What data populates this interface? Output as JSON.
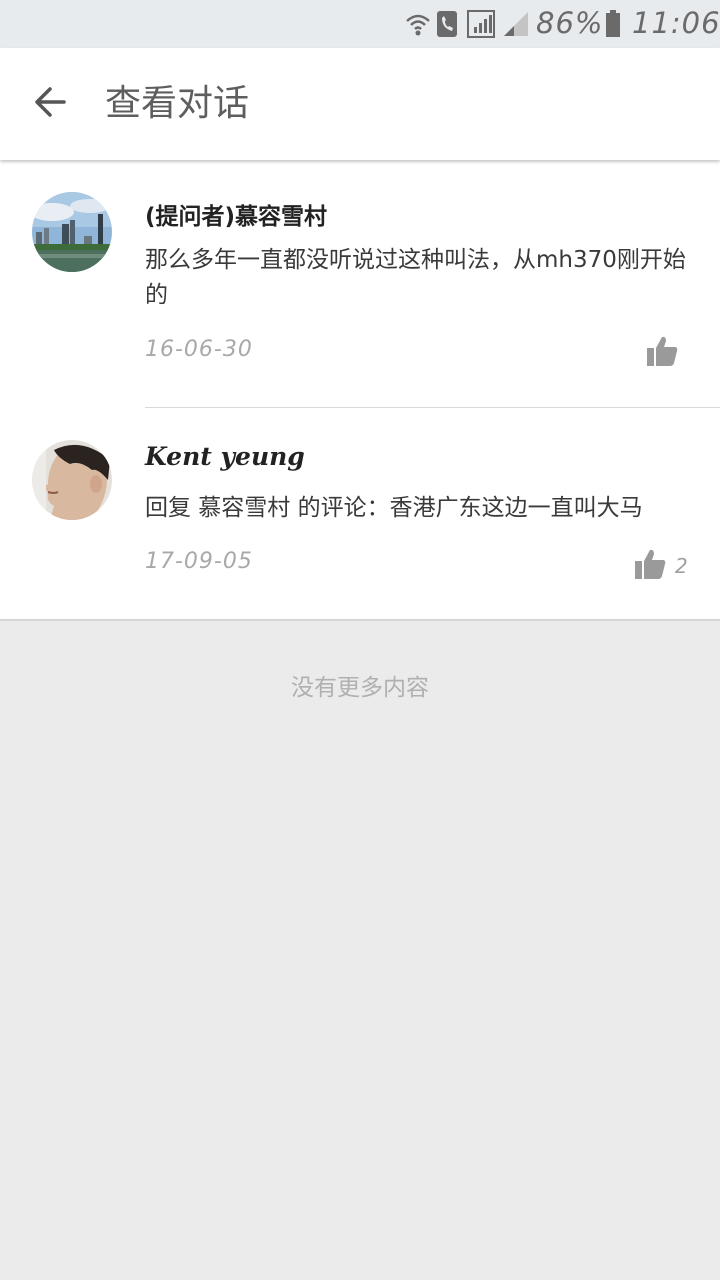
{
  "status_bar": {
    "battery": "86%",
    "time": "11:06",
    "icons": [
      "wifi-calling-icon",
      "phone-icon",
      "signal-icon",
      "signal-weak-icon",
      "battery-icon"
    ]
  },
  "header": {
    "back_icon": "arrow-left-icon",
    "title": "查看对话"
  },
  "comments": [
    {
      "author": "(提问者)慕容雪村",
      "text": "那么多年一直都没听说过这种叫法，从mh370刚开始的",
      "date": "16-06-30",
      "likes": ""
    },
    {
      "author": "Kent yeung",
      "text": "回复 慕容雪村 的评论：香港广东这边一直叫大马",
      "date": "17-09-05",
      "likes": "2"
    }
  ],
  "footer": {
    "no_more": "没有更多内容"
  },
  "colors": {
    "status_bar_bg": "#e8ebee",
    "page_bg": "#ebebeb",
    "icon_gray": "#9a9a9a"
  }
}
